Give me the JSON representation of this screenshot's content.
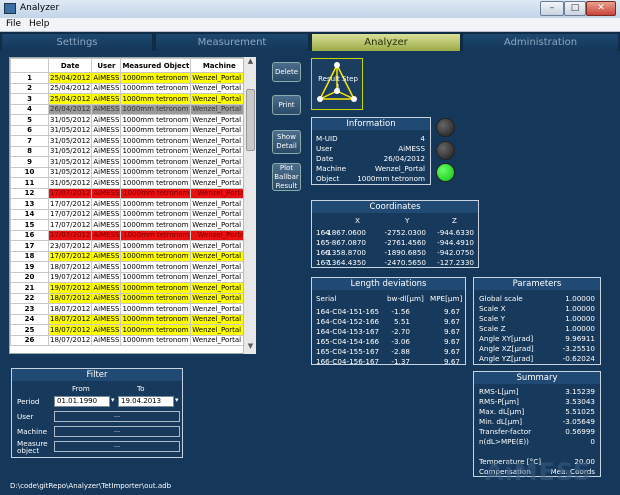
{
  "window": {
    "title": "Analyzer"
  },
  "menu": {
    "file": "File",
    "help": "Help"
  },
  "tabs": [
    {
      "label": "Settings"
    },
    {
      "label": "Measurement"
    },
    {
      "label": "Analyzer"
    },
    {
      "label": "Administration"
    }
  ],
  "grid": {
    "headers": [
      "",
      "Date",
      "User",
      "Measured Object",
      "Machine"
    ],
    "rows": [
      [
        "1",
        "25/04/2012",
        "AiMESS",
        "1000mm tetronom",
        "Wenzel_Portal"
      ],
      [
        "2",
        "25/04/2012",
        "AiMESS",
        "1000mm tetronom",
        "Wenzel_Portal"
      ],
      [
        "3",
        "25/04/2012",
        "AiMESS",
        "1000mm tetronom",
        "Wenzel_Portal"
      ],
      [
        "4",
        "26/04/2012",
        "AiMESS",
        "1000mm tetronom",
        "Wenzel_Portal"
      ],
      [
        "5",
        "31/05/2012",
        "AiMESS",
        "1000mm tetronom",
        "Wenzel_Portal"
      ],
      [
        "6",
        "31/05/2012",
        "AiMESS",
        "1000mm tetronom",
        "Wenzel_Portal"
      ],
      [
        "7",
        "31/05/2012",
        "AiMESS",
        "1000mm tetronom",
        "Wenzel_Portal"
      ],
      [
        "8",
        "31/05/2012",
        "AiMESS",
        "1000mm tetronom",
        "Wenzel_Portal"
      ],
      [
        "9",
        "31/05/2012",
        "AiMESS",
        "1000mm tetronom",
        "Wenzel_Portal"
      ],
      [
        "10",
        "31/05/2012",
        "AiMESS",
        "1000mm tetronom",
        "Wenzel_Portal"
      ],
      [
        "11",
        "31/05/2012",
        "AiMESS",
        "1000mm tetronom",
        "Wenzel_Portal"
      ],
      [
        "12",
        "17/07/2012",
        "AiMESS",
        "1000mm tetronom",
        "Wenzel_Portal"
      ],
      [
        "13",
        "17/07/2012",
        "AiMESS",
        "1000mm tetronom",
        "Wenzel_Portal"
      ],
      [
        "14",
        "17/07/2012",
        "AiMESS",
        "1000mm tetronom",
        "Wenzel_Portal"
      ],
      [
        "15",
        "17/07/2012",
        "AiMESS",
        "1000mm tetronom",
        "Wenzel_Portal"
      ],
      [
        "16",
        "17/07/2012",
        "AiMESS",
        "1000mm tetronom",
        "Wenzel_Portal"
      ],
      [
        "17",
        "23/07/2012",
        "AiMESS",
        "1000mm tetronom",
        "Wenzel_Portal"
      ],
      [
        "18",
        "17/07/2012",
        "AiMESS",
        "1000mm tetronom",
        "Wenzel_Portal"
      ],
      [
        "19",
        "18/07/2012",
        "AiMESS",
        "1000mm tetronom",
        "Wenzel_Portal"
      ],
      [
        "20",
        "19/07/2012",
        "AiMESS",
        "1000mm tetronom",
        "Wenzel_Portal"
      ],
      [
        "21",
        "19/07/2012",
        "AiMESS",
        "1000mm tetronom",
        "Wenzel_Portal"
      ],
      [
        "22",
        "18/07/2012",
        "AiMESS",
        "1000mm tetronom",
        "Wenzel_Portal"
      ],
      [
        "23",
        "18/07/2012",
        "AiMESS",
        "1000mm tetronom",
        "Wenzel_Portal"
      ],
      [
        "24",
        "18/07/2012",
        "AiMESS",
        "1000mm tetronom",
        "Wenzel_Portal"
      ],
      [
        "25",
        "18/07/2012",
        "AiMESS",
        "1000mm tetronom",
        "Wenzel_Portal"
      ],
      [
        "26",
        "18/07/2012",
        "AiMESS",
        "1000mm tetronom",
        "Wenzel_Portal"
      ]
    ],
    "row_colors": [
      "y",
      "w",
      "y",
      "g",
      "w",
      "w",
      "w",
      "w",
      "w",
      "w",
      "w",
      "r",
      "w",
      "w",
      "w",
      "r",
      "w",
      "y",
      "w",
      "w",
      "y",
      "y",
      "w",
      "y",
      "y",
      "w"
    ]
  },
  "filter": {
    "title": "Filter",
    "from_label": "From",
    "to_label": "To",
    "period_label": "Period",
    "from_value": "01.01.1990",
    "to_value": "19.04.2013",
    "user_label": "User",
    "machine_label": "Machine",
    "measure_label": "Measure object",
    "dropdown": "---"
  },
  "buttons": {
    "delete": "Delete",
    "print": "Print",
    "show_detail": "Show Detail",
    "plot": "Plot Ballbar Result"
  },
  "result_step": "Result Step 1",
  "information": {
    "title": "Information",
    "rows": [
      [
        "M-UID",
        "4"
      ],
      [
        "User",
        "AiMESS"
      ],
      [
        "Date",
        "26/04/2012"
      ],
      [
        "Machine",
        "Wenzel_Portal"
      ],
      [
        "Object",
        "1000mm tetronom"
      ]
    ]
  },
  "coordinates": {
    "title": "Coordinates",
    "headers": [
      "X",
      "Y",
      "Z"
    ],
    "rows": [
      [
        "164",
        "-1867.0600",
        "-2752.0300",
        "-944.6330"
      ],
      [
        "165",
        "-867.0870",
        "-2761.4560",
        "-944.4910"
      ],
      [
        "166",
        "-1358.8700",
        "-1890.6850",
        "-942.0750"
      ],
      [
        "167",
        "-1364.4350",
        "-2470.5650",
        "-127.2330"
      ]
    ]
  },
  "length": {
    "title": "Length deviations",
    "headers": [
      "Serial",
      "bw-dl[µm]",
      "MPE[µm]"
    ],
    "rows": [
      [
        "164-C04-151-165",
        "-1.56",
        "9.67"
      ],
      [
        "164-C04-152-166",
        "5.51",
        "9.67"
      ],
      [
        "164-C04-153-167",
        "-2.70",
        "9.67"
      ],
      [
        "165-C04-154-166",
        "-3.06",
        "9.67"
      ],
      [
        "165-C04-155-167",
        "-2.88",
        "9.67"
      ],
      [
        "166-C04-156-167",
        "-1.37",
        "9.67"
      ]
    ]
  },
  "parameters": {
    "title": "Parameters",
    "rows": [
      [
        "Global scale",
        "1.00000"
      ],
      [
        "Scale X",
        "1.00000"
      ],
      [
        "Scale Y",
        "1.00000"
      ],
      [
        "Scale Z",
        "1.00000"
      ],
      [
        "Angle XY[µrad]",
        "9.96911"
      ],
      [
        "Angle XZ[µrad]",
        "-3.25510"
      ],
      [
        "Angle YZ[µrad]",
        "-0.62024"
      ]
    ]
  },
  "summary": {
    "title": "Summary",
    "rows": [
      [
        "RMS-L[µm]",
        "3.15239"
      ],
      [
        "RMS-P[µm]",
        "3.53043"
      ],
      [
        "Max. dL[µm]",
        "5.51025"
      ],
      [
        "Min. dL[µm]",
        "-3.05649"
      ],
      [
        "Transfer-factor",
        "0.56999"
      ],
      [
        "n(dL>MPE(E))",
        "0"
      ]
    ],
    "temp_label": "Temperature [°C]",
    "temp_value": "20.00",
    "comp_label": "Compensation",
    "comp_value": "Mea. Coords"
  },
  "status_path": "D:\\code\\gitRepo\\Analyzer\\TetImporter\\out.adb",
  "watermark": "AiMESS"
}
